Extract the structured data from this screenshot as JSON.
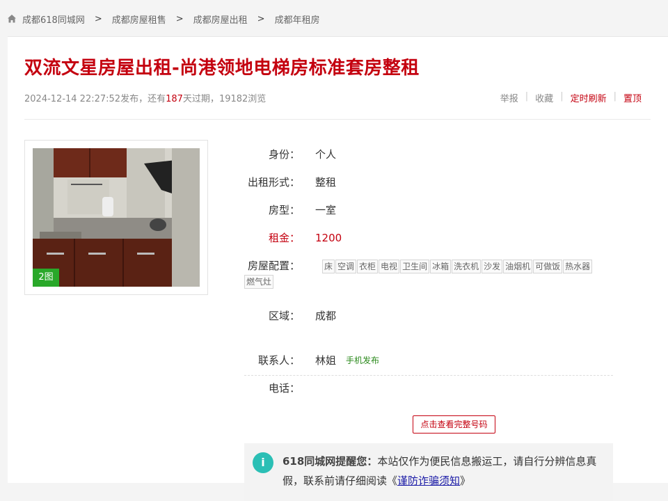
{
  "breadcrumb": {
    "items": [
      "成都618同城网",
      "成都房屋租售",
      "成都房屋出租",
      "成都年租房"
    ],
    "separator": ">"
  },
  "listing": {
    "title": "双流文星房屋出租-尚港领地电梯房标准套房整租",
    "posted_datetime": "2024-12-14 22:27:52发布",
    "expire_prefix": "，还有",
    "expire_days": "187",
    "expire_suffix": "天过期，",
    "views": "19182浏览"
  },
  "actions": {
    "report": "举报",
    "favorite": "收藏",
    "refresh": "定时刷新",
    "pin": "置顶",
    "divider": "|"
  },
  "photo": {
    "count_label": "2图"
  },
  "details": {
    "identity": {
      "label": "身份：",
      "value": "个人"
    },
    "rent_type": {
      "label": "出租形式：",
      "value": "整租"
    },
    "layout": {
      "label": "房型：",
      "value": "一室"
    },
    "rent": {
      "label": "租金：",
      "value": "1200"
    },
    "amenities": {
      "label": "房屋配置：",
      "items": [
        "床",
        "空调",
        "衣柜",
        "电视",
        "卫生间",
        "冰箱",
        "洗衣机",
        "沙发",
        "油烟机",
        "可做饭",
        "热水器",
        "燃气灶"
      ]
    },
    "area": {
      "label": "区域：",
      "value": "成都"
    }
  },
  "contact": {
    "person_label": "联系人：",
    "person": "林姐",
    "mobile_tag": "手机发布",
    "phone_label": "电话：",
    "view_button": "点击查看完整号码"
  },
  "notice": {
    "icon": "info-icon",
    "heading": "618同城网提醒您：",
    "body": "本站仅作为便民信息搬运工，请自行分辨信息真假，联系前请仔细阅读《",
    "link": "谨防诈骗须知",
    "tail": "》"
  },
  "colors": {
    "accent_red": "#c4000f",
    "badge_green": "#29a829",
    "info_teal": "#2bbfb5"
  }
}
